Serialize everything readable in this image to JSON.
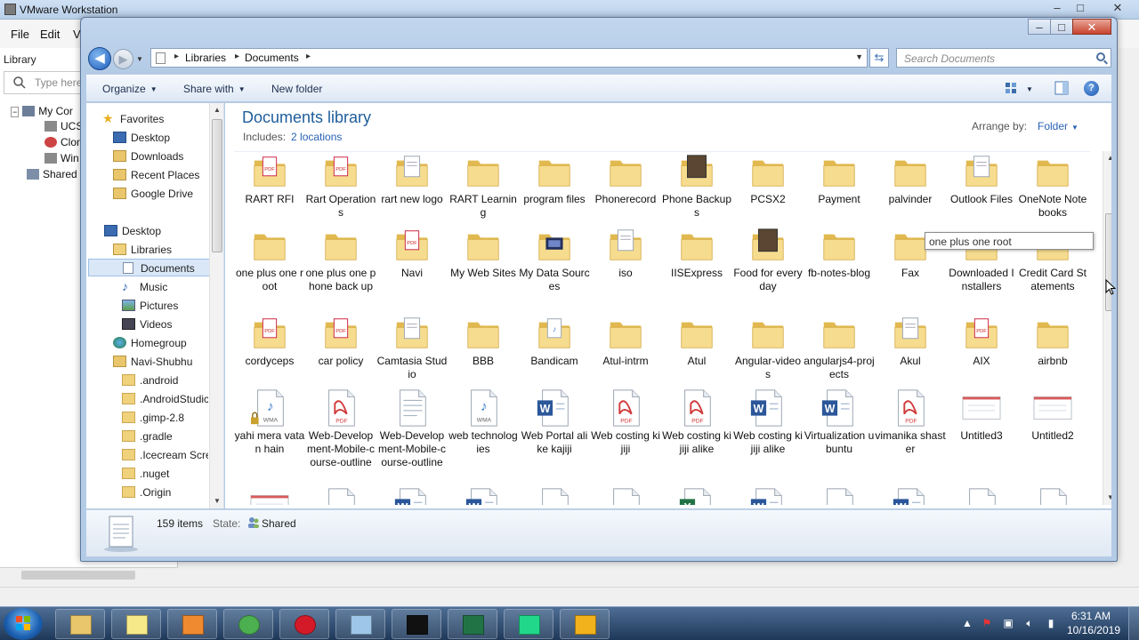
{
  "vmware": {
    "title": "VMware Workstation",
    "menu": [
      "File",
      "Edit",
      "V"
    ],
    "library_label": "Library",
    "search_placeholder": "Type here",
    "tree": [
      "My Cor",
      "UCS",
      "Clon",
      "Win",
      "Shared "
    ]
  },
  "explorer": {
    "window_controls": {
      "minimize": "–",
      "maximize": "□",
      "close": "✕"
    },
    "breadcrumb": [
      "Libraries",
      "Documents"
    ],
    "search_placeholder": "Search Documents",
    "toolbar": {
      "organize": "Organize",
      "share_with": "Share with",
      "new_folder": "New folder"
    },
    "nav": {
      "favorites": "Favorites",
      "fav_items": [
        "Desktop",
        "Downloads",
        "Recent Places",
        "Google Drive"
      ],
      "desktop": "Desktop",
      "libraries": "Libraries",
      "lib_items": [
        "Documents",
        "Music",
        "Pictures",
        "Videos"
      ],
      "homegroup": "Homegroup",
      "user": "Navi-Shubhu",
      "user_items": [
        ".android",
        ".AndroidStudic",
        ".gimp-2.8",
        ".gradle",
        ".Icecream Scre",
        ".nuget",
        ".Origin"
      ]
    },
    "library_title": "Documents library",
    "includes_label": "Includes:",
    "includes_link": "2 locations",
    "arrange_label": "Arrange by:",
    "arrange_value": "Folder",
    "items": [
      {
        "label": "RART RFI",
        "icon": "folder-pdf-icon"
      },
      {
        "label": "Rart Operations",
        "icon": "folder-pdf-icon"
      },
      {
        "label": "rart new logo",
        "icon": "folder-doc-icon"
      },
      {
        "label": "RART Learning",
        "icon": "folder-icon"
      },
      {
        "label": "program files",
        "icon": "folder-icon"
      },
      {
        "label": "Phonerecord",
        "icon": "folder-icon"
      },
      {
        "label": "Phone Backups",
        "icon": "folder-photo-icon"
      },
      {
        "label": "PCSX2",
        "icon": "folder-icon"
      },
      {
        "label": "Payment",
        "icon": "folder-icon"
      },
      {
        "label": "palvinder",
        "icon": "folder-icon"
      },
      {
        "label": "Outlook Files",
        "icon": "folder-doc-icon"
      },
      {
        "label": "OneNote Notebooks",
        "icon": "folder-icon"
      },
      {
        "label": "one plus one root",
        "icon": "folder-icon"
      },
      {
        "label": "one plus one phone back up",
        "icon": "folder-icon"
      },
      {
        "label": "Navi",
        "icon": "folder-pdf-icon"
      },
      {
        "label": "My Web Sites",
        "icon": "folder-icon"
      },
      {
        "label": "My Data Sources",
        "icon": "data-sources-icon"
      },
      {
        "label": "iso",
        "icon": "folder-doc-icon"
      },
      {
        "label": "IISExpress",
        "icon": "folder-icon"
      },
      {
        "label": "Food for everyday",
        "icon": "folder-photo-icon"
      },
      {
        "label": "fb-notes-blog",
        "icon": "folder-icon"
      },
      {
        "label": "Fax",
        "icon": "folder-icon"
      },
      {
        "label": "Downloaded Installers",
        "icon": "folder-icon"
      },
      {
        "label": "Credit Card Statements",
        "icon": "folder-icon"
      },
      {
        "label": "cordyceps",
        "icon": "folder-pdf-icon"
      },
      {
        "label": "car policy",
        "icon": "folder-pdf-icon"
      },
      {
        "label": "Camtasia Studio",
        "icon": "folder-doc-icon"
      },
      {
        "label": "BBB",
        "icon": "folder-icon"
      },
      {
        "label": "Bandicam",
        "icon": "folder-media-icon"
      },
      {
        "label": "Atul-intrm",
        "icon": "folder-icon"
      },
      {
        "label": "Atul",
        "icon": "folder-icon"
      },
      {
        "label": "Angular-videos",
        "icon": "folder-icon"
      },
      {
        "label": "angularjs4-projects",
        "icon": "folder-icon"
      },
      {
        "label": "Akul",
        "icon": "folder-doc-icon"
      },
      {
        "label": "AIX",
        "icon": "folder-pdf-icon"
      },
      {
        "label": "airbnb",
        "icon": "folder-icon"
      },
      {
        "label": "yahi mera vatan hain",
        "icon": "wma-locked-icon"
      },
      {
        "label": "Web-Development-Mobile-course-outline",
        "icon": "pdf-icon"
      },
      {
        "label": "Web-Development-Mobile-course-outline",
        "icon": "text-file-icon"
      },
      {
        "label": "web technologies",
        "icon": "wma-icon"
      },
      {
        "label": "Web Portal alike kajiji",
        "icon": "word-icon"
      },
      {
        "label": "Web costing kijiji",
        "icon": "pdf-icon"
      },
      {
        "label": "Web costing kijiji alike",
        "icon": "pdf-icon"
      },
      {
        "label": "Web costing kijiji alike",
        "icon": "word-icon"
      },
      {
        "label": "Virtualization ubuntu",
        "icon": "word-icon"
      },
      {
        "label": "vimanika shaster",
        "icon": "pdf-icon"
      },
      {
        "label": "Untitled3",
        "icon": "image-file-icon"
      },
      {
        "label": "Untitled2",
        "icon": "image-file-icon"
      },
      {
        "label": "",
        "icon": "image-file-icon"
      },
      {
        "label": "",
        "icon": "media-file-icon"
      },
      {
        "label": "",
        "icon": "word-icon"
      },
      {
        "label": "",
        "icon": "word-icon"
      },
      {
        "label": "",
        "icon": "media-file-icon"
      },
      {
        "label": "",
        "icon": "blank-file-icon"
      },
      {
        "label": "",
        "icon": "excel-icon"
      },
      {
        "label": "",
        "icon": "word-icon"
      },
      {
        "label": "",
        "icon": "blank-file-icon"
      },
      {
        "label": "",
        "icon": "word-icon"
      },
      {
        "label": "",
        "icon": "media-file-icon"
      },
      {
        "label": "",
        "icon": "media-file-icon"
      }
    ],
    "tooltip": "one plus one root",
    "status": {
      "count": "159 items",
      "state_label": "State:",
      "state_value": "Shared"
    }
  },
  "taskbar": {
    "apps": [
      "explorer-icon",
      "sticky-notes-icon",
      "media-player-icon",
      "chrome-icon",
      "opera-icon",
      "notepad-icon",
      "cmd-icon",
      "excel-icon",
      "pycharm-icon",
      "vmware-icon"
    ],
    "time": "6:31 AM",
    "date": "10/16/2019"
  },
  "colors": {
    "accent": "#1e5d9b",
    "link": "#2861b6",
    "folder": "#f3d681"
  }
}
